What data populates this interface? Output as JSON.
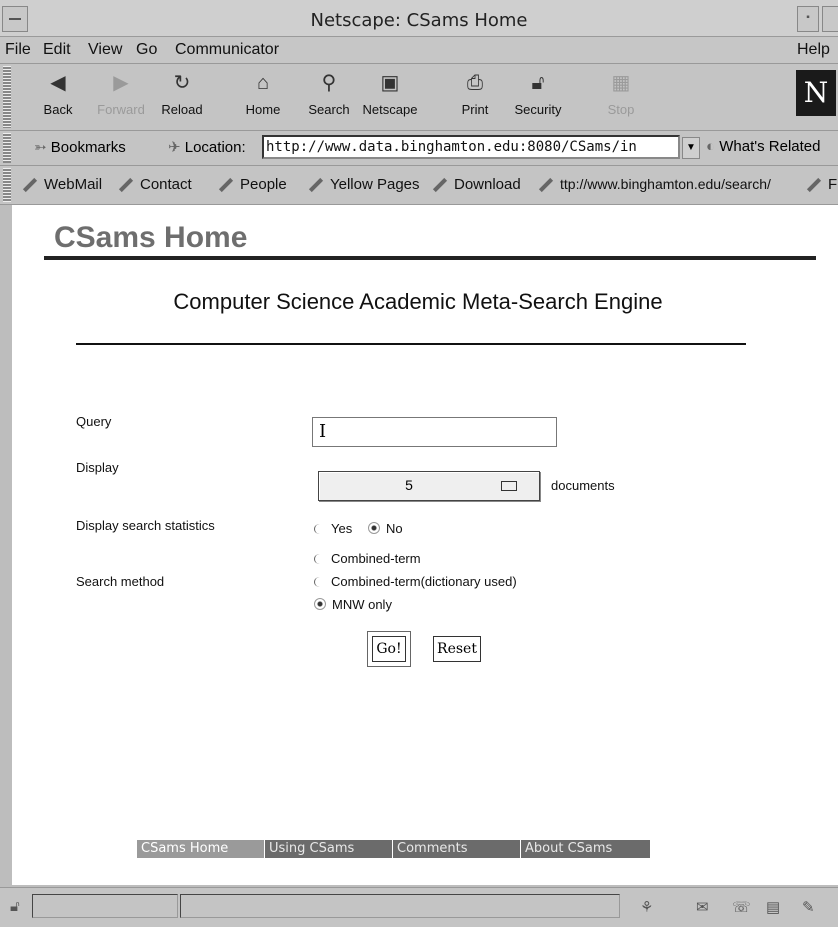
{
  "window": {
    "title": "Netscape: CSams Home"
  },
  "menu": [
    "File",
    "Edit",
    "View",
    "Go",
    "Communicator",
    "Help"
  ],
  "toolbar": {
    "buttons": [
      {
        "label": "Back",
        "icon": "back-arrow-icon",
        "enabled": true
      },
      {
        "label": "Forward",
        "icon": "forward-arrow-icon",
        "enabled": false
      },
      {
        "label": "Reload",
        "icon": "reload-icon",
        "enabled": true
      },
      {
        "label": "Home",
        "icon": "home-icon",
        "enabled": true
      },
      {
        "label": "Search",
        "icon": "search-icon",
        "enabled": true
      },
      {
        "label": "Netscape",
        "icon": "my-netscape-icon",
        "enabled": true
      },
      {
        "label": "Print",
        "icon": "print-icon",
        "enabled": true
      },
      {
        "label": "Security",
        "icon": "lock-icon",
        "enabled": true
      },
      {
        "label": "Stop",
        "icon": "stop-icon",
        "enabled": false
      }
    ],
    "logo_letter": "N"
  },
  "location": {
    "bookmarks_label": "Bookmarks",
    "location_label": "Location:",
    "url": "http://www.data.binghamton.edu:8080/CSams/in",
    "whats_related_label": "What's Related"
  },
  "personal_toolbar": [
    "WebMail",
    "Contact",
    "People",
    "Yellow Pages",
    "Download",
    "ttp://www.binghamton.edu/search/",
    "F"
  ],
  "page": {
    "heading": "CSams Home",
    "engine_title": "Computer Science Academic Meta-Search Engine",
    "form": {
      "query_label": "Query",
      "query_value": "I",
      "display_label": "Display",
      "display_value": "5",
      "display_suffix": "documents",
      "stats_label": "Display search statistics",
      "stats_options": [
        {
          "label": "Yes",
          "selected": false
        },
        {
          "label": "No",
          "selected": true
        }
      ],
      "method_label": "Search method",
      "method_options": [
        {
          "label": "Combined-term",
          "selected": false
        },
        {
          "label": "Combined-term(dictionary used)",
          "selected": false
        },
        {
          "label": "MNW only",
          "selected": true
        }
      ],
      "go_label": "Go!",
      "reset_label": "Reset"
    },
    "nav_tabs": [
      {
        "label": "CSams Home",
        "active": true
      },
      {
        "label": "Using CSams",
        "active": false
      },
      {
        "label": "Comments",
        "active": false
      },
      {
        "label": "About CSams",
        "active": false
      }
    ]
  },
  "colors": {
    "heading": "#6e6e6e",
    "nav_tab": "#6b6b6b",
    "nav_tab_active": "#9a9a9a",
    "chrome": "#c4c4c4"
  }
}
